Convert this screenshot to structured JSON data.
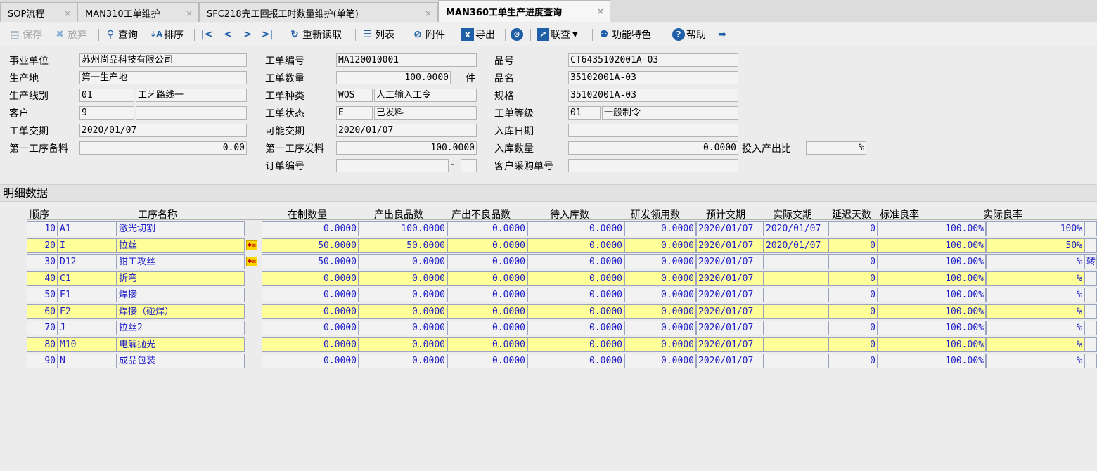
{
  "tabs": [
    {
      "label": "SOP流程",
      "close": "×"
    },
    {
      "label": "MAN310工单维护",
      "close": "×"
    },
    {
      "label": "SFC218完工回报工时数量维护(单笔)",
      "close": "×"
    },
    {
      "label": "MAN360工单生产进度查询",
      "close": "×"
    }
  ],
  "toolbar": {
    "save": "保存",
    "discard": "放弃",
    "query": "查询",
    "sort": "排序",
    "reload": "重新读取",
    "list": "列表",
    "attach": "附件",
    "export": "导出",
    "link": "联查",
    "feature": "功能特色",
    "help": "帮助"
  },
  "form": {
    "labels": {
      "unit": "事业单位",
      "site": "生产地",
      "line": "生产线别",
      "customer": "客户",
      "due": "工单交期",
      "first_prep": "第一工序备料",
      "wo_no": "工单编号",
      "wo_qty": "工单数量",
      "wo_type": "工单种类",
      "wo_status": "工单状态",
      "possible_due": "可能交期",
      "first_issue": "第一工序发料",
      "order_no": "订单编号",
      "part_no": "品号",
      "part_name": "品名",
      "spec": "规格",
      "wo_level": "工单等级",
      "in_date": "入库日期",
      "in_qty": "入库数量",
      "cust_po": "客户采购单号",
      "ratio": "投入产出比"
    },
    "values": {
      "unit": "苏州尚品科技有限公司",
      "site": "第一生产地",
      "line_code": "01",
      "line_name": "工艺路线一",
      "customer_code": "9",
      "customer_name": "",
      "due": "2020/01/07",
      "first_prep": "0.00",
      "wo_no": "MA120010001",
      "wo_qty": "100.0000",
      "wo_unit": "件",
      "wo_type_code": "WOS",
      "wo_type_name": "人工输入工令",
      "wo_status_code": "E",
      "wo_status_name": "已发料",
      "possible_due": "2020/01/07",
      "first_issue": "100.0000",
      "order_no": "",
      "order_seq": "",
      "order_dash": "-",
      "part_no": "CT6435102001A-03",
      "part_name": "35102001A-03",
      "spec": "35102001A-03",
      "wo_level_code": "01",
      "wo_level_name": "一般制令",
      "in_date": "",
      "in_qty": "0.0000",
      "cust_po": "",
      "ratio_pct": "%"
    }
  },
  "detail": {
    "title": "明细数据",
    "headers": {
      "seq": "顺序",
      "proc": "工序名称",
      "wip": "在制数量",
      "good": "产出良品数",
      "bad": "产出不良品数",
      "pending": "待入库数",
      "rd": "研发领用数",
      "plan": "预计交期",
      "actual": "实际交期",
      "delay": "延迟天数",
      "std_yield": "标准良率",
      "act_yield": "实际良率"
    },
    "rows": [
      {
        "seq": "10",
        "code": "A1",
        "name": "激光切割",
        "wip": "0.0000",
        "good": "100.0000",
        "bad": "0.0000",
        "pending": "0.0000",
        "rd": "0.0000",
        "plan": "2020/01/07",
        "actual": "2020/01/07",
        "delay": "0",
        "std": "100.00%",
        "act": "100%",
        "extra": "",
        "flag": false,
        "yellow": false
      },
      {
        "seq": "20",
        "code": "I",
        "name": "拉丝",
        "wip": "50.0000",
        "good": "50.0000",
        "bad": "0.0000",
        "pending": "0.0000",
        "rd": "0.0000",
        "plan": "2020/01/07",
        "actual": "2020/01/07",
        "delay": "0",
        "std": "100.00%",
        "act": "50%",
        "extra": "",
        "flag": true,
        "yellow": true
      },
      {
        "seq": "30",
        "code": "D12",
        "name": "钳工攻丝",
        "wip": "50.0000",
        "good": "0.0000",
        "bad": "0.0000",
        "pending": "0.0000",
        "rd": "0.0000",
        "plan": "2020/01/07",
        "actual": "",
        "delay": "0",
        "std": "100.00%",
        "act": "%",
        "extra": "转",
        "flag": true,
        "yellow": false
      },
      {
        "seq": "40",
        "code": "C1",
        "name": "折弯",
        "wip": "0.0000",
        "good": "0.0000",
        "bad": "0.0000",
        "pending": "0.0000",
        "rd": "0.0000",
        "plan": "2020/01/07",
        "actual": "",
        "delay": "0",
        "std": "100.00%",
        "act": "%",
        "extra": "",
        "flag": false,
        "yellow": true
      },
      {
        "seq": "50",
        "code": "F1",
        "name": "焊接",
        "wip": "0.0000",
        "good": "0.0000",
        "bad": "0.0000",
        "pending": "0.0000",
        "rd": "0.0000",
        "plan": "2020/01/07",
        "actual": "",
        "delay": "0",
        "std": "100.00%",
        "act": "%",
        "extra": "",
        "flag": false,
        "yellow": false
      },
      {
        "seq": "60",
        "code": "F2",
        "name": "焊接（碰焊）",
        "wip": "0.0000",
        "good": "0.0000",
        "bad": "0.0000",
        "pending": "0.0000",
        "rd": "0.0000",
        "plan": "2020/01/07",
        "actual": "",
        "delay": "0",
        "std": "100.00%",
        "act": "%",
        "extra": "",
        "flag": false,
        "yellow": true
      },
      {
        "seq": "70",
        "code": "J",
        "name": "拉丝2",
        "wip": "0.0000",
        "good": "0.0000",
        "bad": "0.0000",
        "pending": "0.0000",
        "rd": "0.0000",
        "plan": "2020/01/07",
        "actual": "",
        "delay": "0",
        "std": "100.00%",
        "act": "%",
        "extra": "",
        "flag": false,
        "yellow": false
      },
      {
        "seq": "80",
        "code": "M10",
        "name": "电解抛光",
        "wip": "0.0000",
        "good": "0.0000",
        "bad": "0.0000",
        "pending": "0.0000",
        "rd": "0.0000",
        "plan": "2020/01/07",
        "actual": "",
        "delay": "0",
        "std": "100.00%",
        "act": "%",
        "extra": "",
        "flag": false,
        "yellow": true
      },
      {
        "seq": "90",
        "code": "N",
        "name": "成品包装",
        "wip": "0.0000",
        "good": "0.0000",
        "bad": "0.0000",
        "pending": "0.0000",
        "rd": "0.0000",
        "plan": "2020/01/07",
        "actual": "",
        "delay": "0",
        "std": "100.00%",
        "act": "%",
        "extra": "",
        "flag": false,
        "yellow": false
      }
    ]
  },
  "colors": {
    "row_yellow": "#ffff99",
    "cell_text": "#1d1dc8",
    "flag": "#ffd700"
  }
}
